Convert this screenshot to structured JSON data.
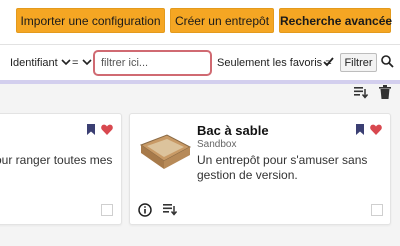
{
  "toolbar": {
    "import_label": "Importer une configuration",
    "create_label": "Créer un entrepôt",
    "advanced_label": "Recherche avancée"
  },
  "filters": {
    "field_label": "Identifiant",
    "operator_label": "=",
    "search_placeholder": "filtrer ici...",
    "search_value": "",
    "favorites_label": "Seulement les favoris =",
    "favorites_checked": true,
    "filter_button": "Filtrer"
  },
  "cards": [
    {
      "description": "our ranger toutes mes"
    },
    {
      "title": "Bac à sable",
      "subtitle": "Sandbox",
      "description_line1": "Un entrepôt pour s'amuser sans",
      "description_line2": "gestion de version."
    }
  ],
  "colors": {
    "accent": "#f5a623",
    "bookmark": "#3b3f73",
    "heart": "#d8484f",
    "strip": "#d3cfee",
    "focus_border": "#d06a72"
  }
}
